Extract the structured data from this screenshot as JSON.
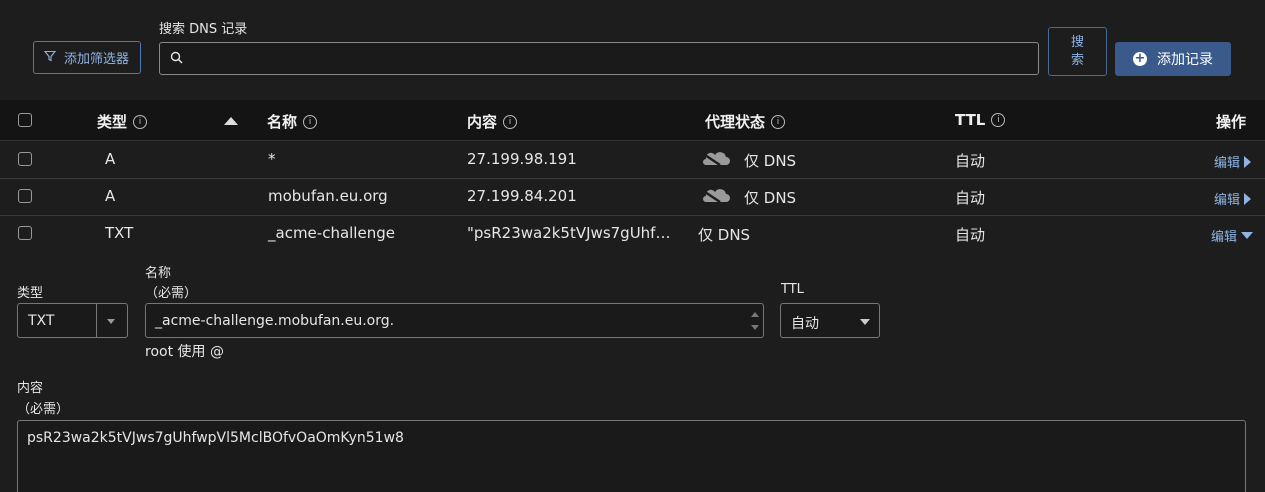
{
  "toolbar": {
    "filter_label": "添加筛选器",
    "search_label": "搜索 DNS 记录",
    "search_value": "",
    "search_button": "搜索",
    "add_record": "添加记录"
  },
  "table": {
    "headers": {
      "type": "类型",
      "name": "名称",
      "content": "内容",
      "proxy": "代理状态",
      "ttl": "TTL",
      "actions": "操作"
    },
    "rows": [
      {
        "type": "A",
        "name": "*",
        "content": "27.199.98.191",
        "proxy": "仅 DNS",
        "ttl": "自动",
        "edit": "编辑"
      },
      {
        "type": "A",
        "name": "mobufan.eu.org",
        "content": "27.199.84.201",
        "proxy": "仅 DNS",
        "ttl": "自动",
        "edit": "编辑"
      },
      {
        "type": "TXT",
        "name": "_acme-challenge",
        "content": "\"psR23wa2k5tVJws7gUhf…",
        "proxy": "仅 DNS",
        "ttl": "自动",
        "edit": "编辑"
      }
    ]
  },
  "edit_form": {
    "type_label": "类型",
    "type_value": "TXT",
    "name_label": "名称",
    "name_required": "（必需）",
    "name_value": "_acme-challenge.mobufan.eu.org.",
    "name_hint": "root 使用 @",
    "ttl_label": "TTL",
    "ttl_value": "自动",
    "content_label": "内容",
    "content_required": "（必需）",
    "content_value": "psR23wa2k5tVJws7gUhfwpVl5MclBOfvOaOmKyn51w8"
  },
  "colors": {
    "accent": "#3b5a8c",
    "link": "#8fb4e3",
    "background": "#1d1d1d"
  },
  "icons": [
    "filter-icon",
    "search-icon",
    "plus-circle-icon",
    "info-icon",
    "sort-up-icon",
    "cloud-icon",
    "chevron-right-icon",
    "chevron-down-icon"
  ]
}
